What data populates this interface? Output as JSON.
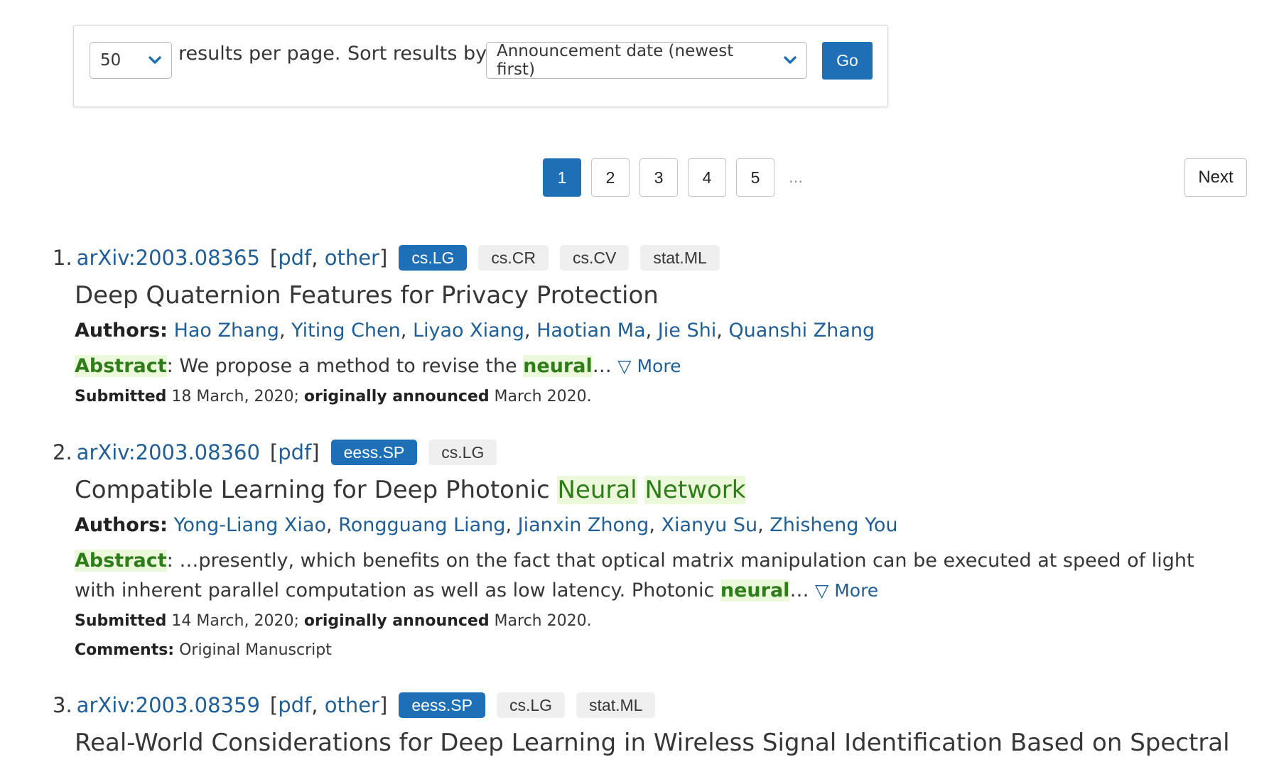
{
  "controls": {
    "per_page_value": "50",
    "per_page_label": "results per page.",
    "sort_label": "Sort results by",
    "sort_value": "Announcement date (newest first)",
    "go_label": "Go"
  },
  "pagination": {
    "pages": [
      "1",
      "2",
      "3",
      "4",
      "5"
    ],
    "current": "1",
    "ellipsis": "…",
    "next_label": "Next"
  },
  "results": [
    {
      "number": "1.",
      "arxiv_id": "arXiv:2003.08365",
      "links_open": "[",
      "links": [
        "pdf",
        "other"
      ],
      "links_close": "]",
      "tags": [
        "cs.LG",
        "cs.CR",
        "cs.CV",
        "stat.ML"
      ],
      "title": "Deep Quaternion Features for Privacy Protection",
      "authors_label": "Authors:",
      "authors": [
        "Hao Zhang",
        "Yiting Chen",
        "Liyao Xiang",
        "Haotian Ma",
        "Jie Shi",
        "Quanshi Zhang"
      ],
      "abstract_label": "Abstract",
      "abstract_text": ": We propose a method to revise the ",
      "abstract_highlight": "neural",
      "abstract_tail": "… ",
      "more_label": "▽ More",
      "submitted_label": "Submitted",
      "submitted_date": " 18 March, 2020; ",
      "announced_label": "originally announced",
      "announced_date": " March 2020."
    },
    {
      "number": "2.",
      "arxiv_id": "arXiv:2003.08360",
      "links_open": "[",
      "links": [
        "pdf"
      ],
      "links_close": "]",
      "tags": [
        "eess.SP",
        "cs.LG"
      ],
      "title_plain": "Compatible Learning for Deep Photonic ",
      "title_hl_1": "Neural",
      "title_hl_2": "Network",
      "authors_label": "Authors:",
      "authors": [
        "Yong-Liang Xiao",
        "Rongguang Liang",
        "Jianxin Zhong",
        "Xianyu Su",
        "Zhisheng You"
      ],
      "abstract_label": "Abstract",
      "abstract_text": ": …presently, which benefits on the fact that optical matrix manipulation can be executed at speed of light with inherent parallel computation as well as low latency. Photonic ",
      "abstract_highlight": "neural",
      "abstract_tail": "… ",
      "more_label": "▽ More",
      "submitted_label": "Submitted",
      "submitted_date": " 14 March, 2020; ",
      "announced_label": "originally announced",
      "announced_date": " March 2020.",
      "comments_label": "Comments:",
      "comments_text": " Original Manuscript"
    },
    {
      "number": "3.",
      "arxiv_id": "arXiv:2003.08359",
      "links_open": "[",
      "links": [
        "pdf",
        "other"
      ],
      "links_close": "]",
      "tags": [
        "eess.SP",
        "cs.LG",
        "stat.ML"
      ],
      "title": "Real-World Considerations for Deep Learning in Wireless Signal Identification Based on Spectral"
    }
  ],
  "colors": {
    "primary_blue": "#1f6fb6",
    "link_blue": "#1f5e96",
    "highlight_green": "#2e7d1a",
    "highlight_bg": "#ebf8d9",
    "tag_gray": "#efefef"
  }
}
